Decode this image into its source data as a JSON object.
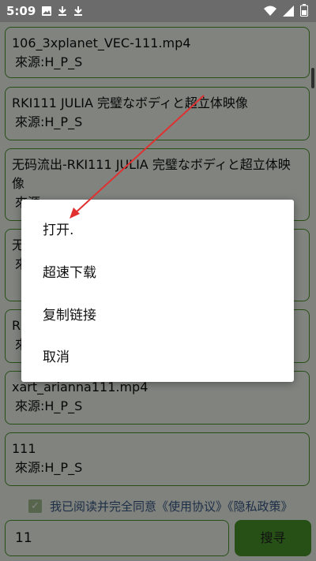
{
  "status_bar": {
    "time": "5:09",
    "left_icons": [
      "image-icon",
      "download-icon",
      "download-icon"
    ],
    "right_icons": [
      "wifi-icon",
      "signal-icon",
      "battery-icon"
    ]
  },
  "results": [
    {
      "title": "106_3xplanet_VEC-111.mp4",
      "source": "來源:H_P_S"
    },
    {
      "title": "RKI111 JULIA 完璧なボディと超立体映像",
      "source": "來源:H_P_S"
    },
    {
      "title": "无码流出-RKI111 JULIA 完璧なボディと超立体映像",
      "source": "來源"
    },
    {
      "title": "无",
      "source": "來"
    },
    {
      "title": "RK",
      "source": "來"
    },
    {
      "title": "xart_arianna111.mp4",
      "source": "來源:H_P_S"
    },
    {
      "title": "111",
      "source": "來源:H_P_S"
    }
  ],
  "agreement": {
    "checked": true,
    "prefix": "我已阅读并完全同意",
    "terms_link": "《使用协议》",
    "privacy_link": "《隐私政策》"
  },
  "search": {
    "value": "11",
    "button_label": "搜寻"
  },
  "dialog": {
    "items": [
      "打开.",
      "超速下载",
      "复制链接",
      "取消"
    ]
  },
  "colors": {
    "accent_green": "#4c9a2c",
    "annotation_red": "#e03030"
  }
}
